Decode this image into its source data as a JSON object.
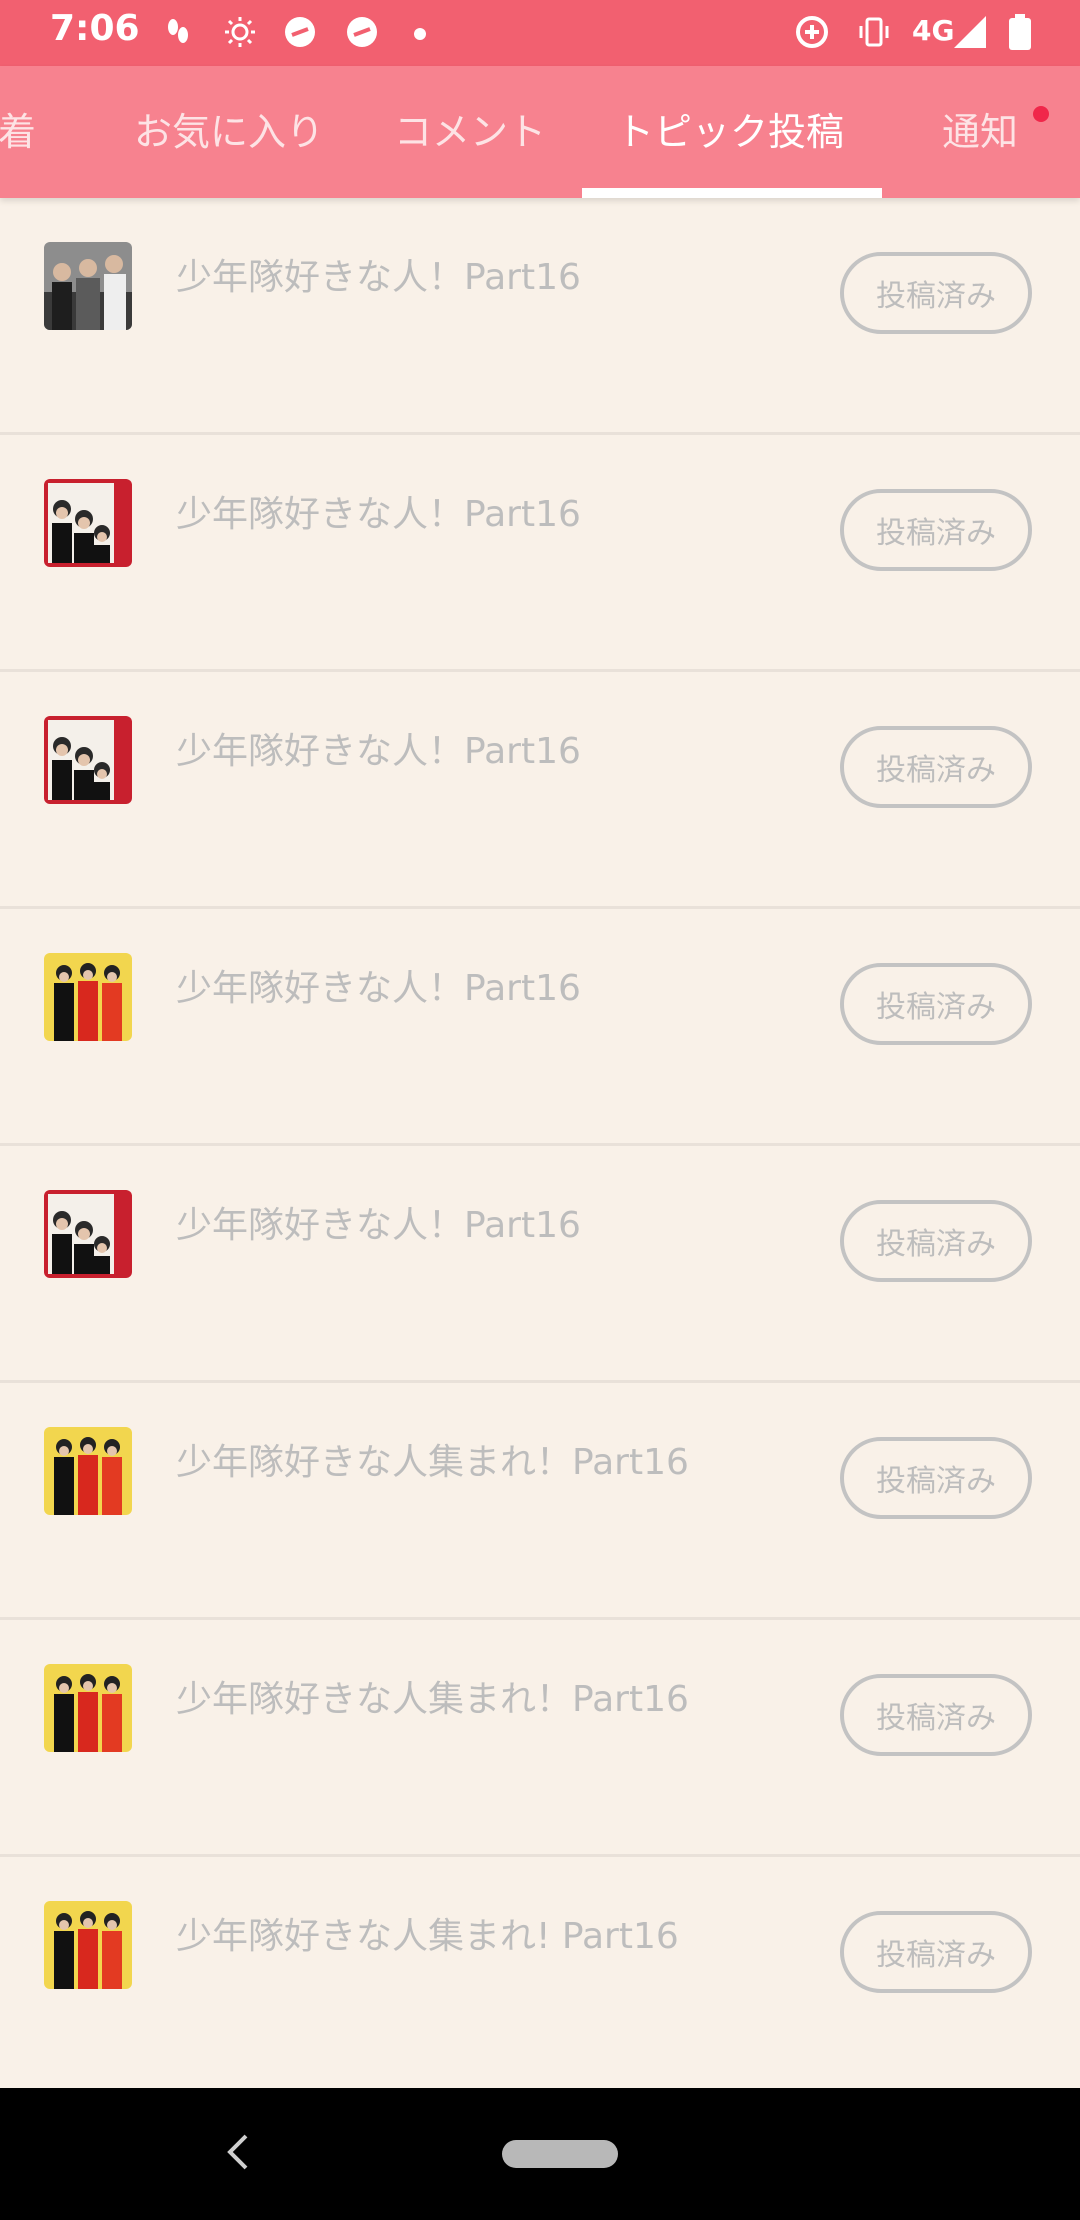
{
  "status_bar": {
    "time": "7:06",
    "network": "4G",
    "icons": [
      "footprints-icon",
      "brightness-icon",
      "app-badge-icon",
      "app-badge-icon",
      "notification-dot-icon",
      "data-saver-icon",
      "vibrate-icon",
      "signal-icon",
      "battery-icon"
    ]
  },
  "tabs": [
    {
      "label": "着",
      "active": false
    },
    {
      "label": "お気に入り",
      "active": false
    },
    {
      "label": "コメント",
      "active": false
    },
    {
      "label": "トピック投稿",
      "active": true
    },
    {
      "label": "通知",
      "active": false,
      "badge": true
    }
  ],
  "list": [
    {
      "title": "少年隊好きな人！Part16",
      "button": "投稿済み",
      "thumb": "dark-group-photo"
    },
    {
      "title": "少年隊好きな人！Part16",
      "button": "投稿済み",
      "thumb": "backstage-pass-photo"
    },
    {
      "title": "少年隊好きな人！Part16",
      "button": "投稿済み",
      "thumb": "backstage-pass-photo"
    },
    {
      "title": "少年隊好きな人！Part16",
      "button": "投稿済み",
      "thumb": "yellow-red-group-photo"
    },
    {
      "title": "少年隊好きな人！Part16",
      "button": "投稿済み",
      "thumb": "backstage-pass-photo"
    },
    {
      "title": "少年隊好きな人集まれ！Part16",
      "button": "投稿済み",
      "thumb": "yellow-red-group-photo"
    },
    {
      "title": "少年隊好きな人集まれ！Part16",
      "button": "投稿済み",
      "thumb": "yellow-red-group-photo"
    },
    {
      "title": "少年隊好きな人集まれ! Part16",
      "button": "投稿済み",
      "thumb": "yellow-red-group-photo"
    }
  ],
  "colors": {
    "status_bar": "#f26070",
    "tab_bar": "#f7828f",
    "background": "#f9f1e8",
    "badge": "#f0274a"
  }
}
